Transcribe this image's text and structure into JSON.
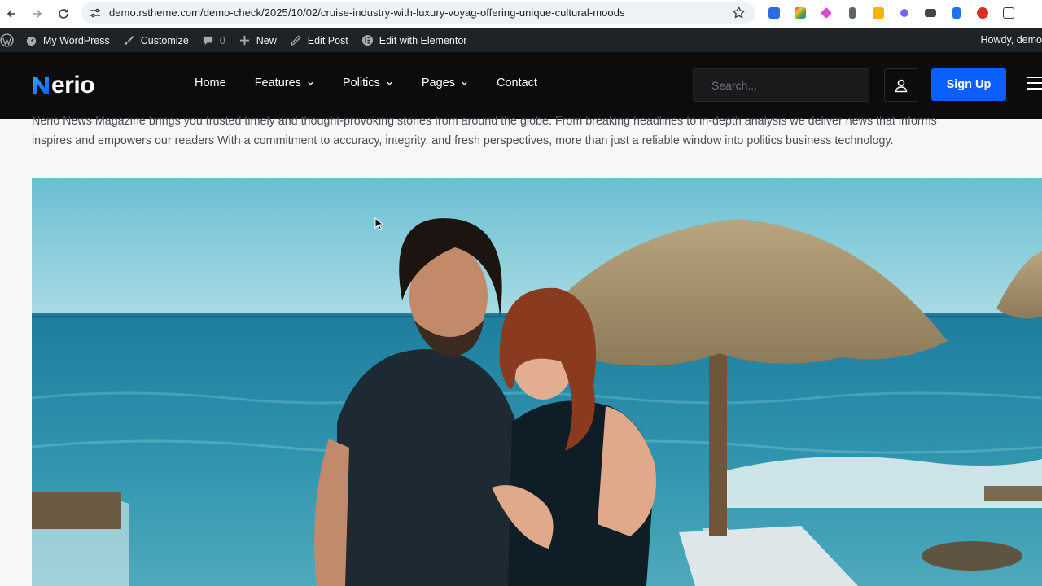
{
  "browser": {
    "url": "demo.rstheme.com/demo-check/2025/10/02/cruise-industry-with-luxury-voyag-offering-unique-cultural-moods",
    "back_icon": "arrow-left-icon",
    "forward_icon": "arrow-right-icon",
    "reload_icon": "reload-icon",
    "bookmark_icon": "star-icon"
  },
  "admin_bar": {
    "my_wordpress": "My WordPress",
    "customize": "Customize",
    "comments_count": "0",
    "new": "New",
    "edit_post": "Edit Post",
    "edit_elementor": "Edit with Elementor",
    "howdy": "Howdy, demo"
  },
  "header": {
    "logo_text": "erio",
    "nav": [
      "Home",
      "Features",
      "Politics",
      "Pages",
      "Contact"
    ],
    "search_placeholder": "Search...",
    "signup": "Sign Up"
  },
  "intro_text": "Nerio News Magazine brings you trusted timely and thought-provoking stories from around the globe. From breaking headlines to in-depth analysis we deliver news that informs inspires and empowers our readers With a commitment to accuracy, integrity, and fresh perspectives, more than just a reliable window into politics business technology.",
  "colors": {
    "accent": "#0a5fff",
    "header_bg": "#0c0c0d",
    "admin_bg": "#1d2327"
  }
}
